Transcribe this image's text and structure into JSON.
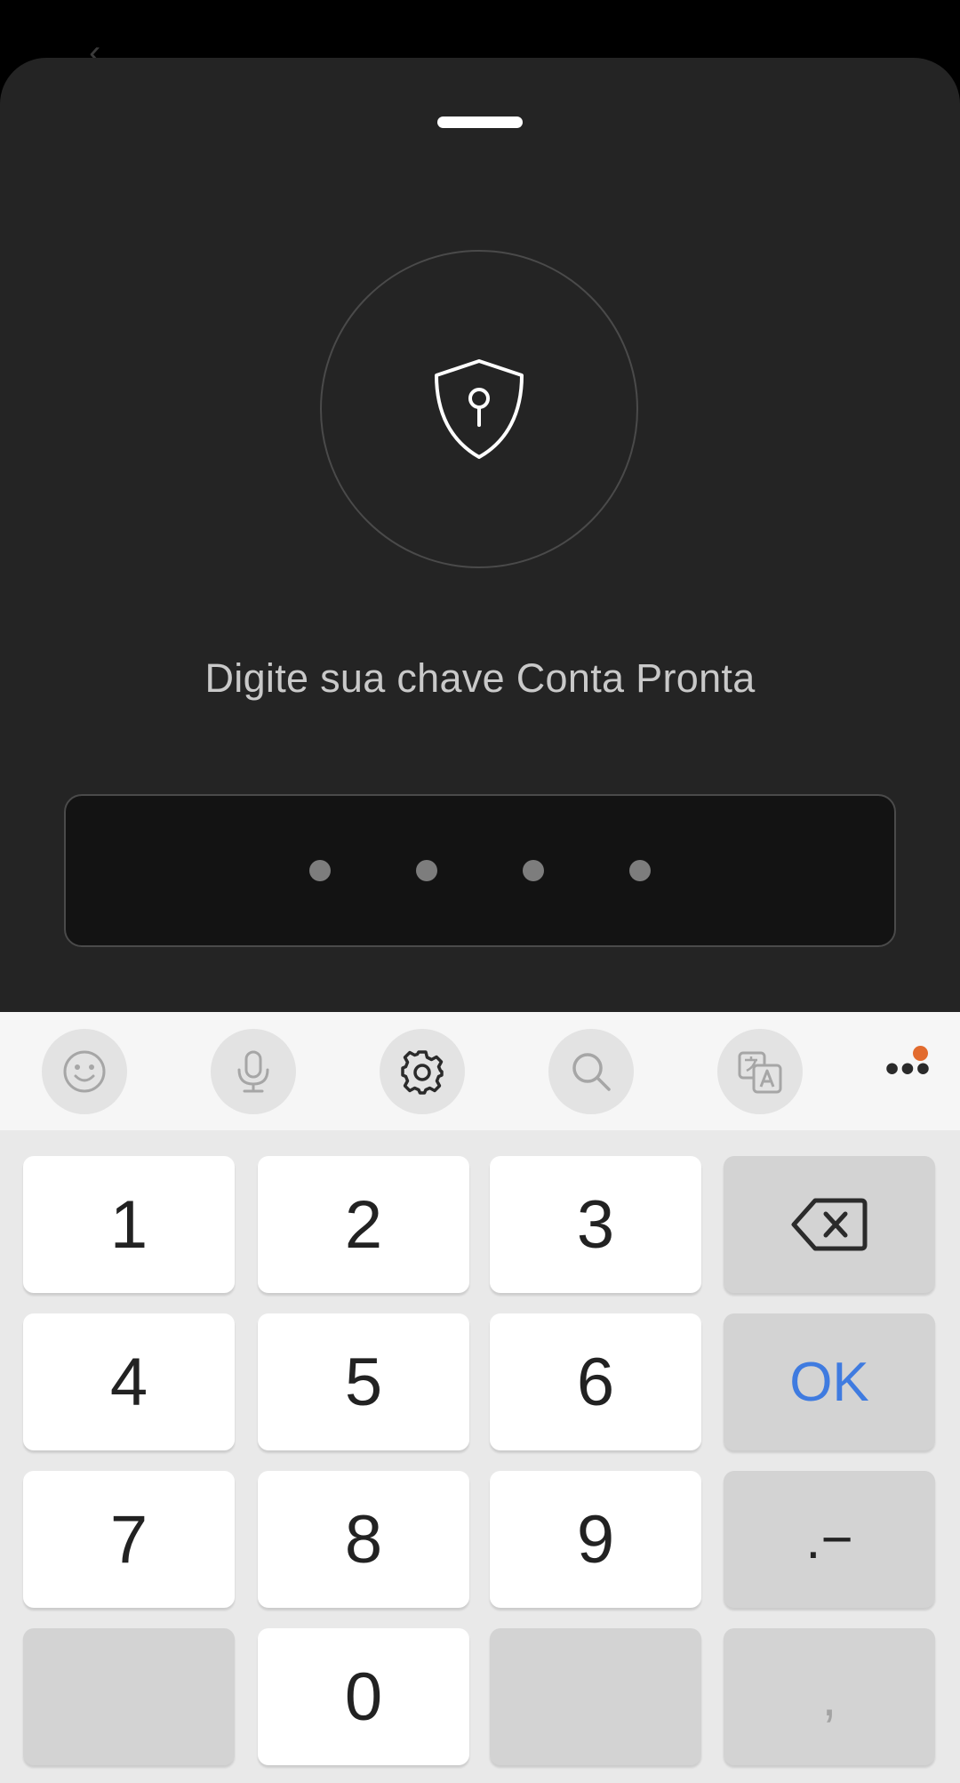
{
  "sheet": {
    "prompt": "Digite sua chave Conta Pronta",
    "pin_dots_count": 4
  },
  "keyboard": {
    "toolbar": [
      {
        "name": "emoji-icon"
      },
      {
        "name": "microphone-icon"
      },
      {
        "name": "gear-icon"
      },
      {
        "name": "search-icon"
      },
      {
        "name": "translate-icon"
      },
      {
        "name": "more-options-icon"
      }
    ],
    "keys": {
      "k1": "1",
      "k2": "2",
      "k3": "3",
      "k4": "4",
      "k5": "5",
      "k6": "6",
      "k7": "7",
      "k8": "8",
      "k9": "9",
      "k0": "0",
      "ok": "OK",
      "dot_dash": ".−",
      "comma": ","
    },
    "accent_color": "#3f7be0",
    "notification_color": "#e26b2e"
  }
}
